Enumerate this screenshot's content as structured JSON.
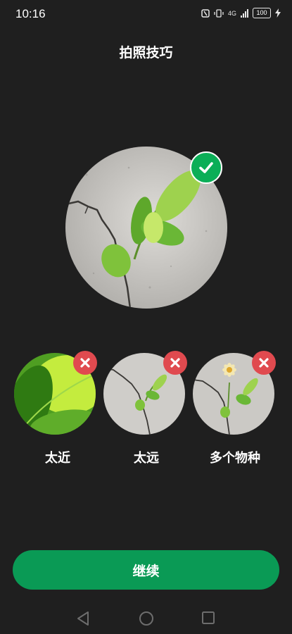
{
  "status_bar": {
    "time": "10:16",
    "network_label": "4G",
    "battery": "100"
  },
  "title": "拍照技巧",
  "good_example": {
    "icon": "check-icon",
    "accent": "#0bae57"
  },
  "bad_examples": [
    {
      "label": "太近",
      "icon": "close-icon"
    },
    {
      "label": "太远",
      "icon": "close-icon"
    },
    {
      "label": "多个物种",
      "icon": "close-icon"
    }
  ],
  "continue_label": "继续",
  "colors": {
    "background": "#1f1f1f",
    "button": "#0a9a55",
    "good_badge": "#0bae57",
    "bad_badge": "#e04a4f"
  },
  "navigation": {
    "back_icon": "back-triangle-icon",
    "home_icon": "home-circle-icon",
    "recents_icon": "recents-square-icon"
  }
}
